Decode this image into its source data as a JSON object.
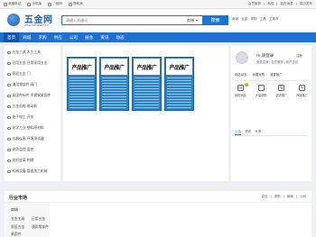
{
  "topbar": {
    "left": [
      "收藏本站",
      "手机版",
      "二维码",
      "帮助我"
    ],
    "right": [
      "会员服务",
      "私信",
      "站内消息",
      "招已发布"
    ]
  },
  "logo": {
    "text": "五金网",
    "sub": "www.hardware.cn"
  },
  "search": {
    "placeholder": "请输入关键词",
    "scope": "商铺",
    "button": "搜索"
  },
  "header_links": [
    "商城",
    "五金",
    "采购",
    "工具",
    "工具市"
  ],
  "nav": [
    "首页",
    "商城",
    "求购",
    "供应",
    "公司",
    "展会",
    "资讯",
    "动态"
  ],
  "sidebar": {
    "items": [
      "五金工具 木工工具",
      "日用五金 日用家用五金",
      "家居五金 门",
      "通用零部件 阀门",
      "紧固件标件 不锈钢紧固件",
      "五金机电 电动机",
      "电子电工 开关",
      "化学工业 塑料原材料",
      "仪器仪表 环境测试器",
      "安防监控 监控",
      "纺织皮革 刺绣",
      "机械设备 管道加工机械"
    ]
  },
  "ads": [
    "产品推广",
    "产品推广",
    "产品推广",
    "产品推广"
  ],
  "user": {
    "greeting": "Hi,请登录",
    "register": "注册",
    "sub": "免费注册 | 会员服务 | 用户协议",
    "buttons": [
      "网站动态",
      "我要采购",
      "我要推广"
    ],
    "icons": [
      {
        "label": "我的消息",
        "glyph": "✉",
        "badge": true
      },
      {
        "label": "大量求购",
        "glyph": "♡",
        "badge": false
      },
      {
        "label": "供求推广",
        "glyph": "⇅",
        "badge": false
      },
      {
        "label": "商城推广",
        "glyph": "✎",
        "badge": false
      }
    ],
    "tabs": [
      "公告",
      "资讯",
      "头条"
    ]
  },
  "market": {
    "title": "行业市场",
    "tabs": [
      "供应",
      "求购",
      "商城",
      "公司"
    ],
    "head": "商城",
    "cats": [
      "五金工具",
      "日用五金",
      "家居五金",
      "通用零部件",
      "紧固件"
    ]
  }
}
